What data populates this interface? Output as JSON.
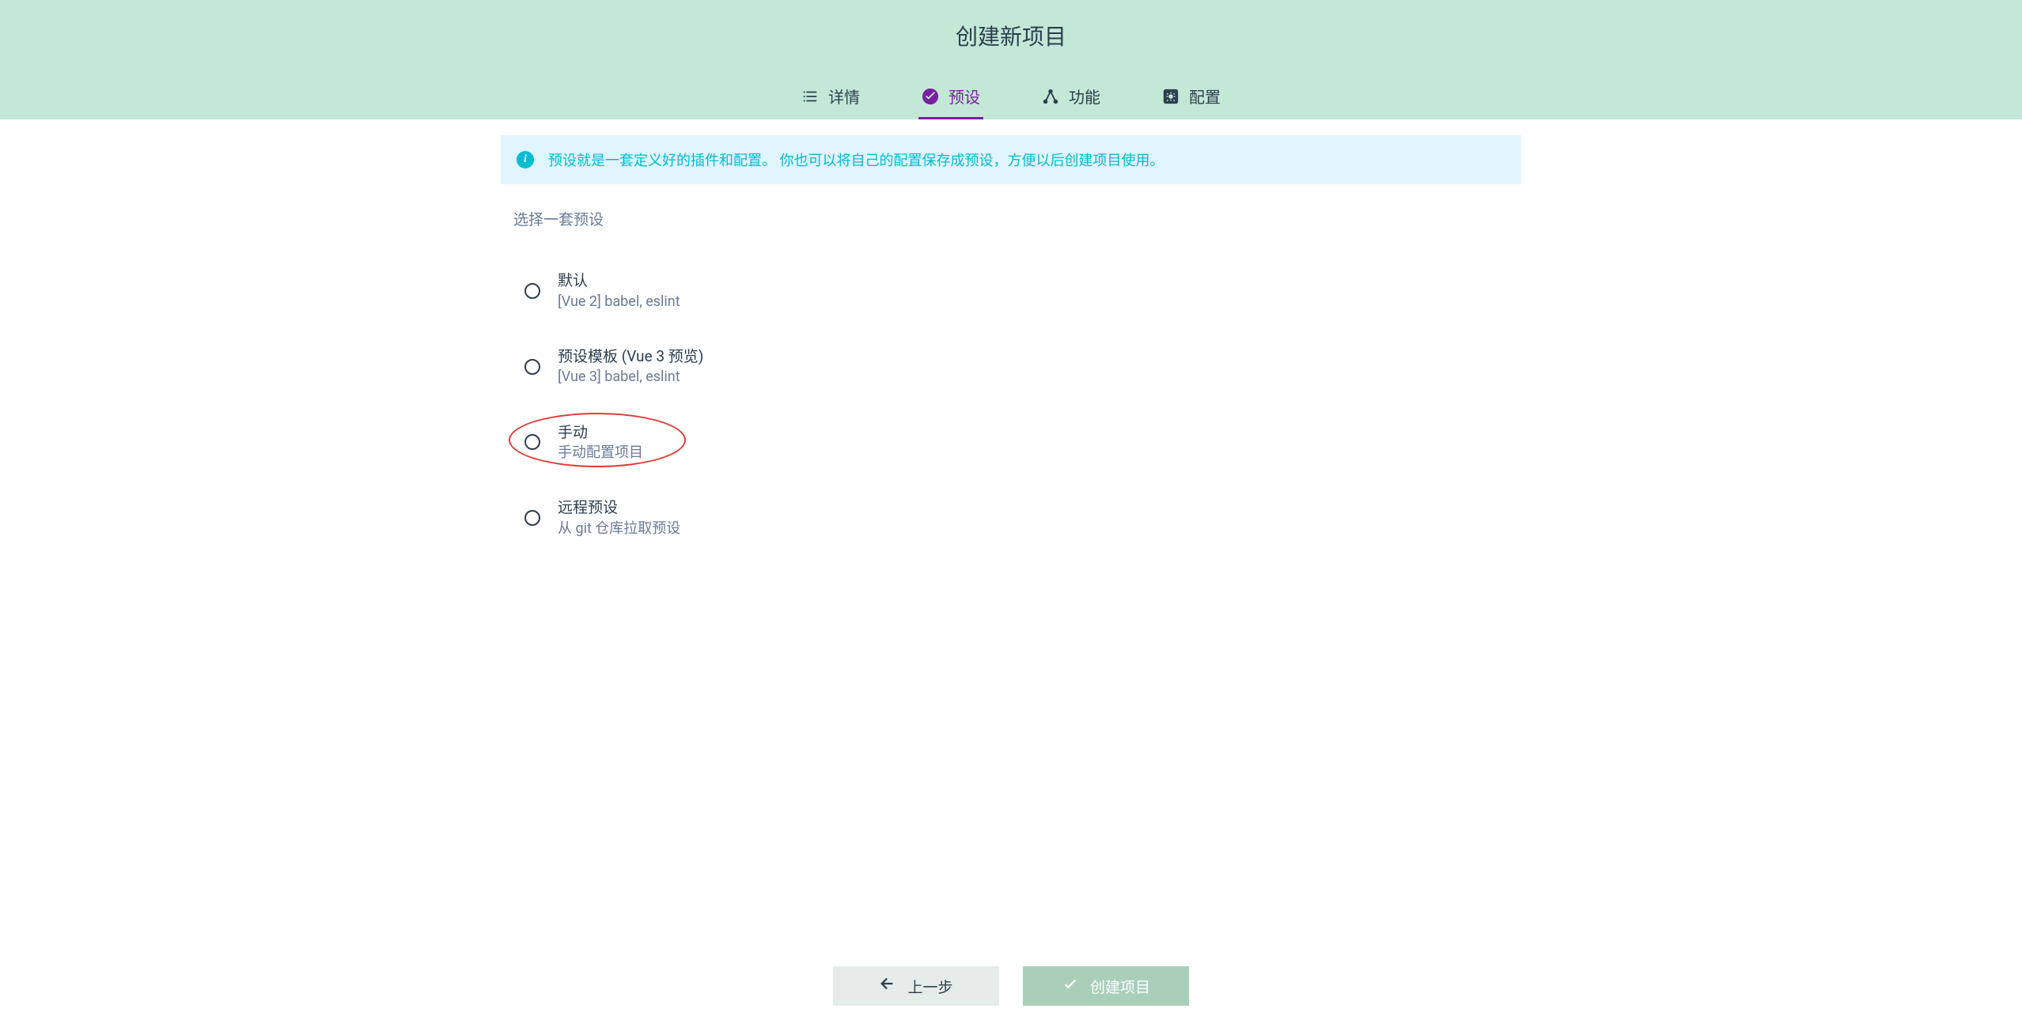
{
  "header": {
    "title": "创建新项目"
  },
  "tabs": [
    {
      "icon": "list-icon",
      "label": "详情"
    },
    {
      "icon": "check-circle-icon",
      "label": "预设",
      "active": true
    },
    {
      "icon": "share-icon",
      "label": "功能"
    },
    {
      "icon": "settings-app-icon",
      "label": "配置"
    }
  ],
  "info": {
    "text": "预设就是一套定义好的插件和配置。 你也可以将自己的配置保存成预设，方便以后创建项目使用。"
  },
  "section_label": "选择一套预设",
  "presets": [
    {
      "title": "默认",
      "subtitle": "[Vue 2] babel, eslint",
      "circled": false
    },
    {
      "title": "预设模板 (Vue 3 预览)",
      "subtitle": "[Vue 3] babel, eslint",
      "circled": false
    },
    {
      "title": "手动",
      "subtitle": "手动配置项目",
      "circled": true
    },
    {
      "title": "远程预设",
      "subtitle": "从 git 仓库拉取预设",
      "circled": false
    }
  ],
  "footer": {
    "back_label": "上一步",
    "create_label": "创建项目"
  }
}
